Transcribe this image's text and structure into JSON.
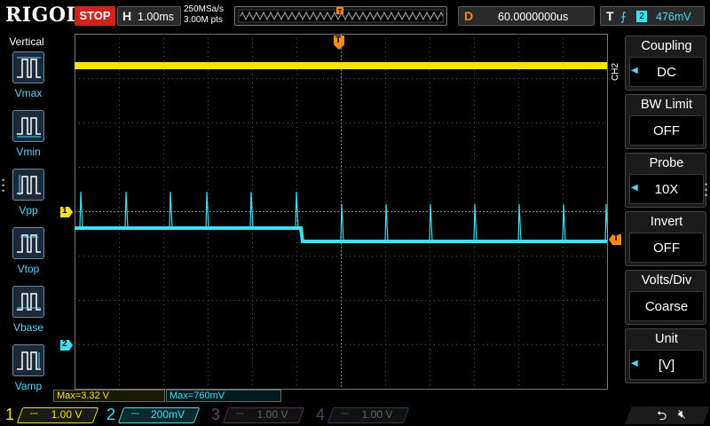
{
  "header": {
    "logo": "RIGOL",
    "run_state": "STOP",
    "horizontal": {
      "letter": "H",
      "timebase": "1.00ms"
    },
    "sample_rate": "250MSa/s",
    "memory_points": "3.00M pts",
    "delay": {
      "letter": "D",
      "value": "60.0000000us"
    },
    "trigger": {
      "letter": "T",
      "source": "2",
      "level": "476mV"
    }
  },
  "left_panel": {
    "title": "Vertical",
    "items": [
      {
        "label": "Vmax",
        "icon": "vmax-icon"
      },
      {
        "label": "Vmin",
        "icon": "vmin-icon"
      },
      {
        "label": "Vpp",
        "icon": "vpp-icon"
      },
      {
        "label": "Vtop",
        "icon": "vtop-icon"
      },
      {
        "label": "Vbase",
        "icon": "vbase-icon"
      },
      {
        "label": "Vamp",
        "icon": "vamp-icon"
      }
    ]
  },
  "right_menu": {
    "channel_tag": "CH2",
    "items": [
      {
        "title": "Coupling",
        "value": "DC"
      },
      {
        "title": "BW Limit",
        "value": "OFF"
      },
      {
        "title": "Probe",
        "value": "10X"
      },
      {
        "title": "Invert",
        "value": "OFF"
      },
      {
        "title": "Volts/Div",
        "value": "Coarse"
      },
      {
        "title": "Unit",
        "value": "[V]"
      }
    ]
  },
  "markers": {
    "ch1_marker": "1",
    "ch2_marker": "2",
    "trigger_marker": "T"
  },
  "readouts": {
    "ch1": "Max=3.32 V",
    "ch2": "Max=760mV"
  },
  "channels": [
    {
      "num": "1",
      "scale": "1.00 V",
      "color": "#f5e01a",
      "active": true
    },
    {
      "num": "2",
      "scale": "200mV",
      "color": "#3ee0f0",
      "active": true
    },
    {
      "num": "3",
      "scale": "1.00 V",
      "color": "#c040c0",
      "active": false
    },
    {
      "num": "4",
      "scale": "1.00 V",
      "color": "#3070e0",
      "active": false
    }
  ],
  "colors": {
    "ch1": "#f5e01a",
    "ch2": "#3ee0f0",
    "trigger": "#ff8a1a",
    "stop": "#d0241a"
  }
}
